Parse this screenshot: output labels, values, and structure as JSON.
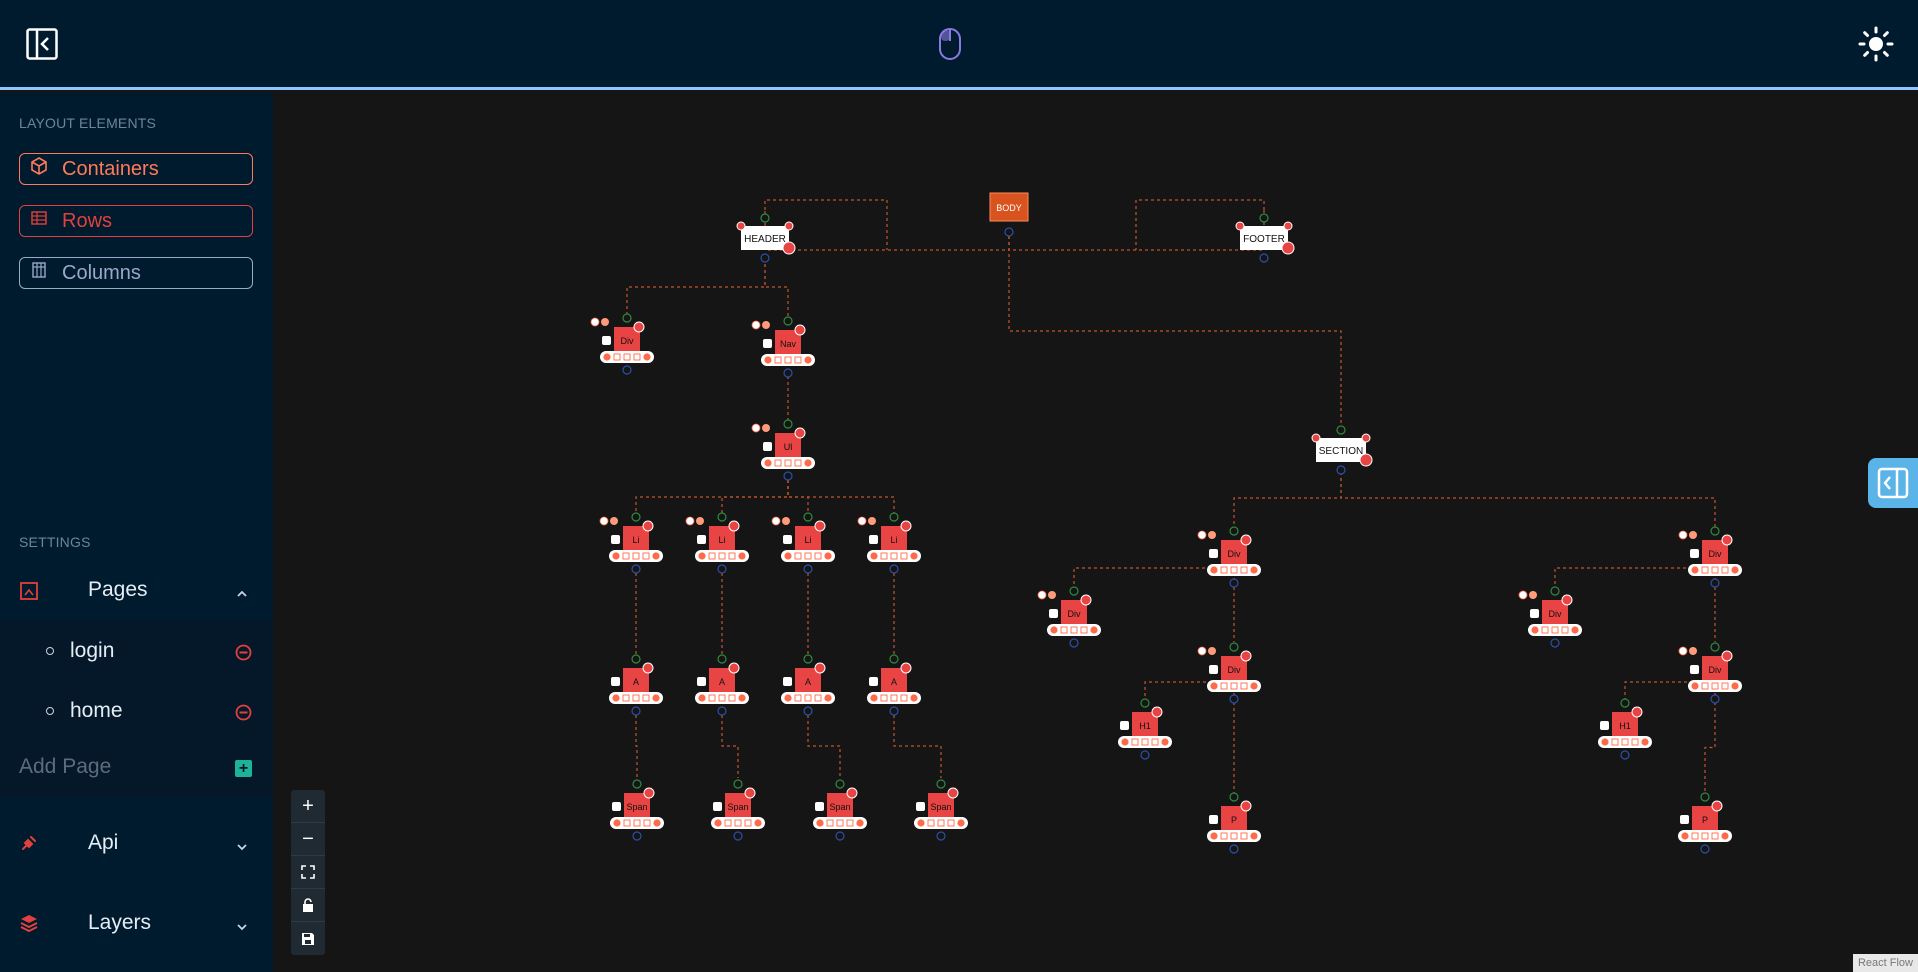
{
  "topbar": {
    "collapse_icon": "sidebar-collapse-icon",
    "mouse_icon": "mouse-icon",
    "theme_icon": "sun-icon"
  },
  "sidebar": {
    "layout_label": "LAYOUT ELEMENTS",
    "elements": [
      {
        "label": "Containers",
        "icon": "cube-icon",
        "color": "#ff7a59"
      },
      {
        "label": "Rows",
        "icon": "rows-icon",
        "color": "#e0413c"
      },
      {
        "label": "Columns",
        "icon": "columns-icon",
        "color": "#9aa9c8"
      }
    ],
    "settings_label": "SETTINGS",
    "pages": {
      "label": "Pages",
      "icon": "pages-icon",
      "items": [
        {
          "name": "login",
          "remove_icon": "minus-circle-icon"
        },
        {
          "name": "home",
          "remove_icon": "minus-circle-icon"
        }
      ],
      "add_placeholder": "Add Page",
      "add_icon": "plus-square-icon"
    },
    "api": {
      "label": "Api",
      "icon": "plug-icon"
    },
    "layers": {
      "label": "Layers",
      "icon": "layers-icon"
    }
  },
  "canvas": {
    "attribution": "React Flow",
    "controls": [
      "zoom-in-icon",
      "zoom-out-icon",
      "fit-view-icon",
      "lock-icon",
      "save-icon"
    ],
    "toggle_icon": "panel-toggle-icon",
    "nodes": {
      "body": "BODY",
      "header": "HEADER",
      "footer": "FOOTER",
      "section": "SECTION",
      "div": "Div",
      "nav": "Nav",
      "ul": "Ul",
      "li": "Li",
      "a": "A",
      "span": "Span",
      "h1": "H1",
      "p": "P"
    }
  },
  "colors": {
    "topbar": "#001a2e",
    "accent": "#ff6b4a",
    "node_red": "#e84444",
    "body_node": "#d9531e",
    "edge": "#c0552e"
  }
}
